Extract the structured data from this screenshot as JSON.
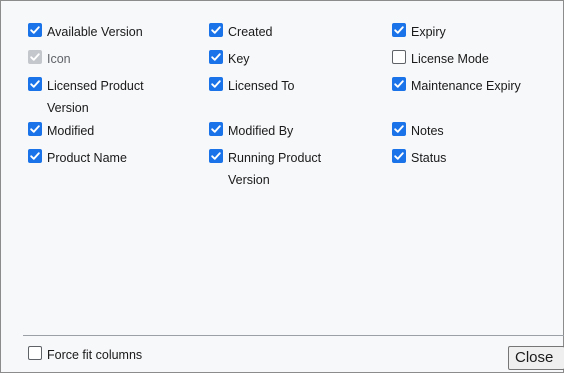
{
  "columns": [
    {
      "label": "Available Version",
      "state": "checked"
    },
    {
      "label": "Created",
      "state": "checked"
    },
    {
      "label": "Expiry",
      "state": "checked"
    },
    {
      "label": "Icon",
      "state": "disabled"
    },
    {
      "label": "Key",
      "state": "checked"
    },
    {
      "label": "License Mode",
      "state": "unchecked"
    },
    {
      "label": "Licensed Product Version",
      "state": "checked"
    },
    {
      "label": "Licensed To",
      "state": "checked"
    },
    {
      "label": "Maintenance Expiry",
      "state": "checked"
    },
    {
      "label": "Modified",
      "state": "checked"
    },
    {
      "label": "Modified By",
      "state": "checked"
    },
    {
      "label": "Notes",
      "state": "checked"
    },
    {
      "label": "Product Name",
      "state": "checked"
    },
    {
      "label": "Running Product Version",
      "state": "checked"
    },
    {
      "label": "Status",
      "state": "checked"
    }
  ],
  "footer": {
    "force_fit_label": "Force fit columns",
    "force_fit_state": "unchecked",
    "close_label": "Close"
  },
  "colors": {
    "accent": "#1a73e8",
    "disabled": "#c4c7cc"
  }
}
